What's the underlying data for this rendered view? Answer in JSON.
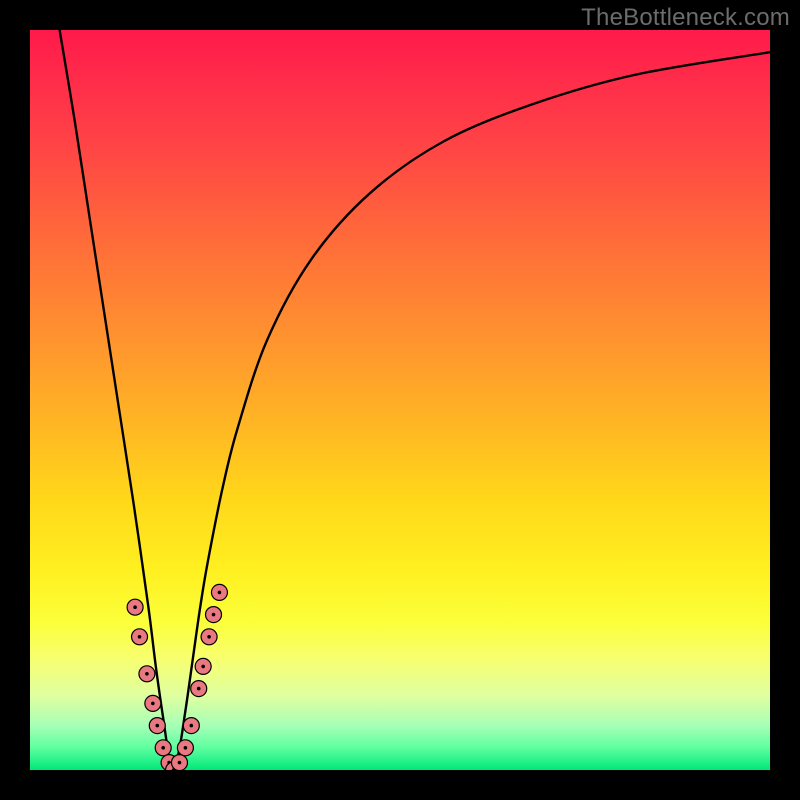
{
  "watermark": {
    "text": "TheBottleneck.com"
  },
  "colors": {
    "frame": "#000000",
    "curve": "#000000",
    "dot_fill": "#e97880",
    "dot_stroke": "#000000",
    "text": "#6c6c6c",
    "gradient_top": "#ff1a4a",
    "gradient_bottom": "#00e878"
  },
  "chart_data": {
    "type": "line",
    "title": "",
    "xlabel": "",
    "ylabel": "",
    "xlim": [
      0,
      100
    ],
    "ylim": [
      0,
      100
    ],
    "legend": false,
    "grid": false,
    "notes": "V-shaped bottleneck curve on a red-to-green gradient. Minimum of curve near x≈19, y≈0. Pink data markers clustered around the valley.",
    "series": [
      {
        "name": "bottleneck_curve",
        "x": [
          4,
          6,
          8,
          10,
          12,
          14,
          16,
          17,
          18,
          19,
          20,
          21,
          22,
          23,
          24,
          26,
          28,
          32,
          38,
          46,
          56,
          68,
          82,
          100
        ],
        "y": [
          100,
          88,
          75,
          62,
          49,
          36,
          22,
          14,
          7,
          1,
          2,
          8,
          15,
          22,
          28,
          38,
          46,
          58,
          69,
          78,
          85,
          90,
          94,
          97
        ]
      }
    ],
    "points": [
      {
        "x": 14.2,
        "y": 22
      },
      {
        "x": 14.8,
        "y": 18
      },
      {
        "x": 15.8,
        "y": 13
      },
      {
        "x": 16.6,
        "y": 9
      },
      {
        "x": 17.2,
        "y": 6
      },
      {
        "x": 18.0,
        "y": 3
      },
      {
        "x": 18.8,
        "y": 1
      },
      {
        "x": 19.4,
        "y": 0
      },
      {
        "x": 20.2,
        "y": 1
      },
      {
        "x": 21.0,
        "y": 3
      },
      {
        "x": 21.8,
        "y": 6
      },
      {
        "x": 22.8,
        "y": 11
      },
      {
        "x": 23.4,
        "y": 14
      },
      {
        "x": 24.2,
        "y": 18
      },
      {
        "x": 24.8,
        "y": 21
      },
      {
        "x": 25.6,
        "y": 24
      }
    ]
  }
}
